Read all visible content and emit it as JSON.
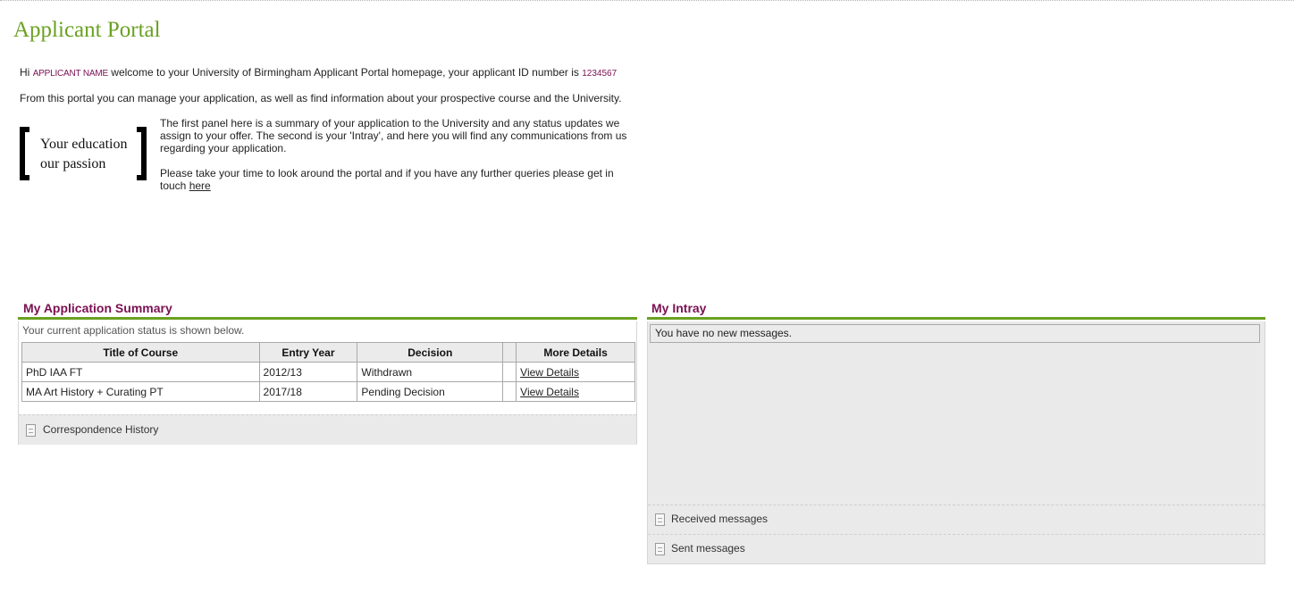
{
  "page": {
    "title": "Applicant Portal"
  },
  "intro": {
    "greeting": "Hi",
    "applicant_name": "APPLICANT NAME",
    "welcome_text": "welcome to your University of Birmingham Applicant Portal homepage, your applicant ID number is",
    "applicant_id": "1234567",
    "line2": "From this portal you can manage your application, as well as find information about your prospective course and the University."
  },
  "slogan": {
    "line1": "Your education",
    "line2": "our passion"
  },
  "blurb": {
    "para1": "The first panel here is a summary of your application to the University and any status updates we assign to your offer. The second is your 'Intray', and here you will find any communications from us regarding your application.",
    "para2_text": "Please take your time to look around the portal and if you have any further queries please get in touch",
    "para2_link": "here"
  },
  "summary": {
    "title": "My Application Summary",
    "caption": "Your current application status is shown below.",
    "columns": [
      "Title of Course",
      "Entry Year",
      "Decision",
      "",
      "More Details"
    ],
    "rows": [
      {
        "course": "PhD IAA FT",
        "year": "2012/13",
        "decision": "Withdrawn",
        "blank": "",
        "details": "View Details"
      },
      {
        "course": "MA Art History + Curating PT",
        "year": "2017/18",
        "decision": "Pending Decision",
        "blank": "",
        "details": "View Details"
      }
    ],
    "footer_link": "Correspondence History"
  },
  "intray": {
    "title": "My Intray",
    "message": "You have no new messages.",
    "received_label": "Received messages",
    "sent_label": "Sent messages"
  },
  "colors": {
    "brand_green": "#6aa121",
    "brand_purple": "#7b1052"
  }
}
